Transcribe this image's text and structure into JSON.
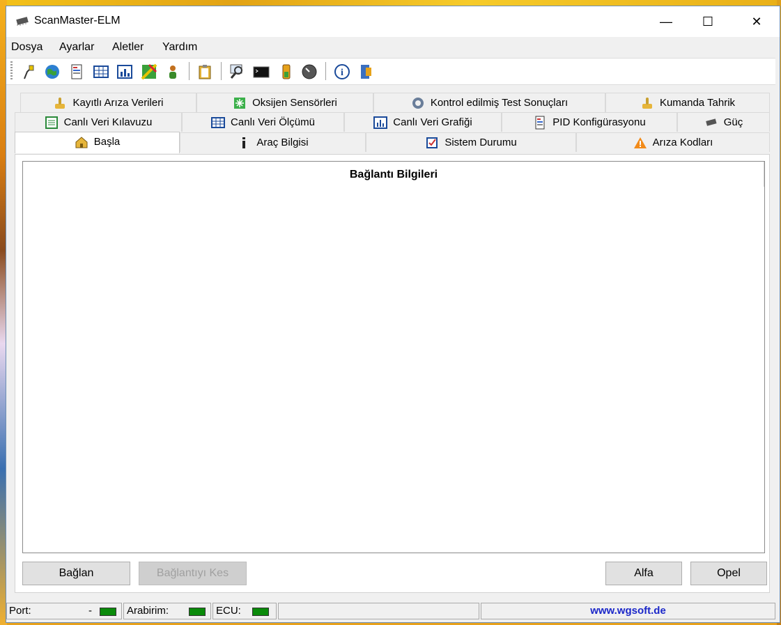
{
  "window": {
    "title": "ScanMaster-ELM",
    "icon": "chip-icon",
    "controls": {
      "minimize": "—",
      "maximize": "☐",
      "close": "✕"
    }
  },
  "menu": [
    "Dosya",
    "Ayarlar",
    "Aletler",
    "Yardım"
  ],
  "toolbar": {
    "icons": [
      "connect-plug-icon",
      "globe-icon",
      "document-icon",
      "grid-icon",
      "bar-chart-icon",
      "map-icon",
      "person-icon",
      "clipboard-icon",
      "magnifier-icon",
      "terminal-icon",
      "battery-icon",
      "gauge-icon",
      "info-icon",
      "exit-icon"
    ]
  },
  "tabs": {
    "row1": [
      {
        "label": "Kayıtlı Arıza Verileri",
        "icon": "joystick-icon"
      },
      {
        "label": "Oksijen Sensörleri",
        "icon": "sensor-icon"
      },
      {
        "label": "Kontrol edilmiş Test Sonuçları",
        "icon": "gear-icon"
      },
      {
        "label": "Kumanda Tahrik",
        "icon": "joystick-icon"
      }
    ],
    "row2": [
      {
        "label": "Canlı Veri Kılavuzu",
        "icon": "list-icon"
      },
      {
        "label": "Canlı Veri Ölçümü",
        "icon": "grid-icon"
      },
      {
        "label": "Canlı Veri Grafiği",
        "icon": "bar-chart-icon"
      },
      {
        "label": "PID Konfigürasyonu",
        "icon": "document-icon"
      },
      {
        "label": "Güç",
        "icon": "chip-icon"
      }
    ],
    "row3": [
      {
        "label": "Başla",
        "icon": "home-icon"
      },
      {
        "label": "Araç Bilgisi",
        "icon": "info-i-icon"
      },
      {
        "label": "Sistem Durumu",
        "icon": "checkbox-icon"
      },
      {
        "label": "Arıza Kodları",
        "icon": "warning-icon"
      }
    ]
  },
  "panel": {
    "title": "Bağlantı Bilgileri",
    "buttons": {
      "connect": "Bağlan",
      "disconnect": "Bağlantıyı Kes",
      "alfa": "Alfa",
      "opel": "Opel"
    }
  },
  "statusbar": {
    "port_label": "Port:",
    "port_value": "-",
    "interface_label": "Arabirim:",
    "ecu_label": "ECU:",
    "link": "www.wgsoft.de",
    "led_color": "#0a8a0a"
  },
  "colors": {
    "link": "#1b27c9",
    "accent_border": "#6c8fb5"
  }
}
